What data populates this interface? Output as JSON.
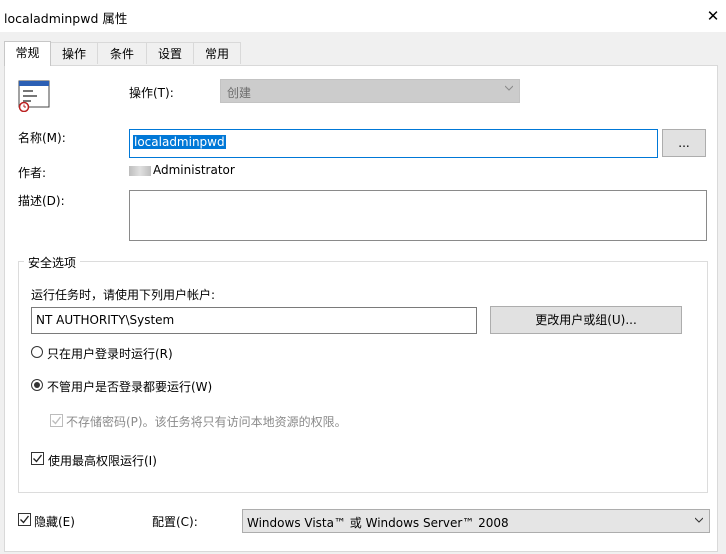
{
  "window": {
    "title": "localadminpwd 属性",
    "close_glyph": "✕"
  },
  "tabs": [
    {
      "label": "常规",
      "active": true
    },
    {
      "label": "操作"
    },
    {
      "label": "条件"
    },
    {
      "label": "设置"
    },
    {
      "label": "常用"
    }
  ],
  "general": {
    "action_label": "操作(T):",
    "action_value": "创建",
    "name_label": "名称(M):",
    "name_value": "localadminpwd",
    "browse_label": "...",
    "author_label": "作者:",
    "author_value": "Administrator",
    "description_label": "描述(D):",
    "description_value": ""
  },
  "security": {
    "group_title": "安全选项",
    "run_as_prompt": "运行任务时，请使用下列用户帐户:",
    "user_account": "NT AUTHORITY\\System",
    "change_user_button": "更改用户或组(U)...",
    "radio_logged_on": "只在用户登录时运行(R)",
    "radio_logged_on_selected": false,
    "radio_whether_logged": "不管用户是否登录都要运行(W)",
    "radio_whether_logged_selected": true,
    "no_store_password": "不存储密码(P)。该任务将只有访问本地资源的权限。",
    "no_store_password_checked": true,
    "highest_privileges": "使用最高权限运行(I)",
    "highest_privileges_checked": true
  },
  "footer": {
    "hidden_label": "隐藏(E)",
    "hidden_checked": true,
    "configure_label": "配置(C):",
    "configure_value": "Windows Vista™ 或 Windows Server™ 2008"
  },
  "icons": [
    "task-icon",
    "close-icon",
    "chevron-down-icon",
    "checkmark-icon"
  ]
}
